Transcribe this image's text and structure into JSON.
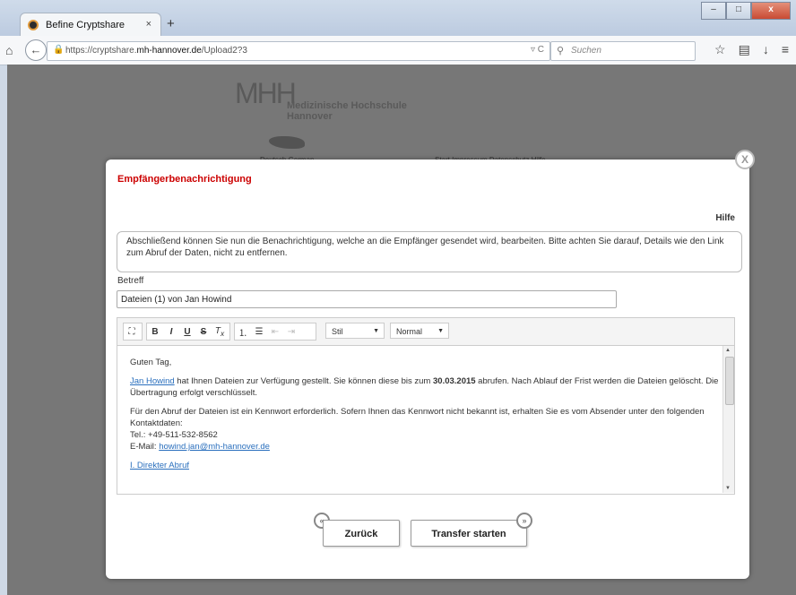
{
  "browser": {
    "tab_title": "Befine Cryptshare",
    "tab_close": "×",
    "new_tab": "+",
    "url_host": "https://cryptshare.",
    "url_domain": "mh-hannover.de",
    "url_path": "/Upload2?3",
    "search_placeholder": "Suchen",
    "url_icons": "▿ C"
  },
  "site": {
    "logo": "MHH",
    "name_line1": "Medizinische Hochschule",
    "name_line2": "Hannover",
    "language": "Deutsch  German",
    "topnav": "Start  Impressum  Datenschutz  Hilfe"
  },
  "modal": {
    "title": "Empfängerbenachrichtigung",
    "help": "Hilfe",
    "info": "Abschließend können Sie nun die Benachrichtigung, welche an die Empfänger gesendet wird, bearbeiten. Bitte achten Sie darauf, Details wie den Link zum Abruf der Daten, nicht zu entfernen.",
    "subject_label": "Betreff",
    "subject_value": "Dateien (1) von Jan Howind",
    "close": "X"
  },
  "editor": {
    "style_dropdown": "Stil",
    "format_dropdown": "Normal",
    "greeting": "Guten Tag,",
    "p1_link": "Jan Howind",
    "p1_text_a": " hat Ihnen Dateien zur Verfügung gestellt. Sie können diese bis zum ",
    "p1_date": "30.03.2015",
    "p1_text_b": " abrufen. Nach Ablauf der Frist werden die Dateien gelöscht. Die Übertragung erfolgt verschlüsselt.",
    "p2_line1": "Für den Abruf der Dateien ist ein Kennwort erforderlich. Sofern Ihnen das Kennwort nicht bekannt ist, erhalten Sie es vom Absender unter den folgenden Kontaktdaten:",
    "p2_phone": "Tel.: +49-511-532-8562",
    "p2_email_label": "E-Mail: ",
    "p2_email": "howind.jan@mh-hannover.de",
    "section": "I. Direkter Abruf"
  },
  "actions": {
    "back": "Zurück",
    "start": "Transfer starten"
  }
}
